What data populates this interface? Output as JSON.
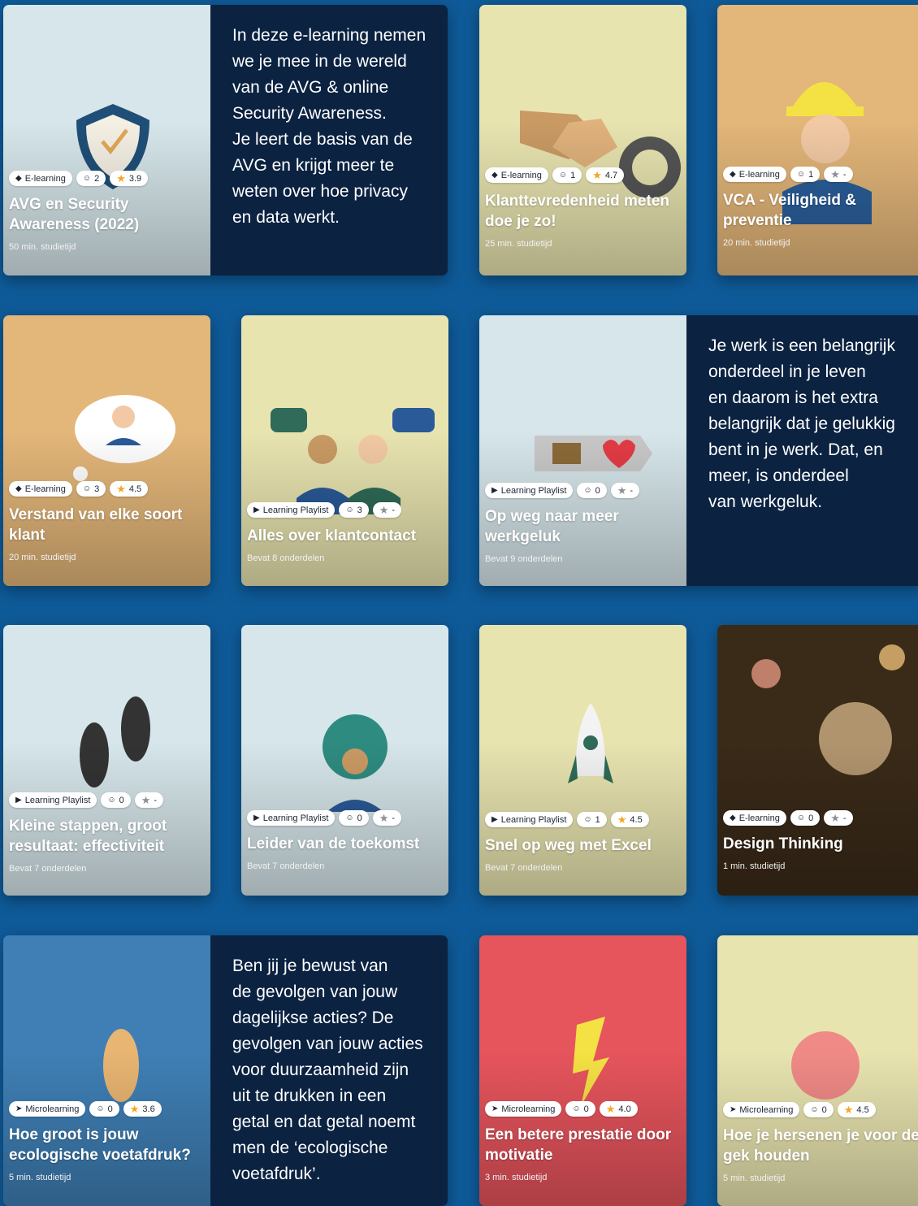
{
  "cards": [
    {
      "type": "E-learning",
      "type_icon": "graduation-cap-icon",
      "enrolled": "2",
      "rating": "3.9",
      "title": "AVG en Security Awareness (2022)",
      "sub": "50 min. studietijd",
      "bg": "#d6e6ea",
      "illustration": "shield-check",
      "description": "In deze e-learning nemen\nwe je mee in de wereld\nvan de AVG & online\nSecurity Awareness.\nJe leert de basis van de\nAVG en krijgt meer te\nweten over hoe privacy\nen data werkt."
    },
    {
      "type": "E-learning",
      "type_icon": "graduation-cap-icon",
      "enrolled": "1",
      "rating": "4.7",
      "title": "Klanttevredenheid meten doe je zo!",
      "sub": "25 min. studietijd",
      "bg": "#e8e4b0",
      "illustration": "handshake-gauge"
    },
    {
      "type": "E-learning",
      "type_icon": "graduation-cap-icon",
      "enrolled": "1",
      "rating": "-",
      "title": "VCA - Veiligheid & preventie",
      "sub": "20 min. studietijd",
      "bg": "#e3b679",
      "illustration": "construction-worker"
    },
    {
      "type": "E-learning",
      "type_icon": "graduation-cap-icon",
      "enrolled": "3",
      "rating": "4.5",
      "title": "Verstand van elke soort klant",
      "sub": "20 min. studietijd",
      "bg": "#e3b679",
      "illustration": "thought-cloud-person"
    },
    {
      "type": "Learning Playlist",
      "type_icon": "play-icon",
      "enrolled": "3",
      "rating": "-",
      "title": "Alles over klantcontact",
      "sub": "Bevat 8 onderdelen",
      "bg": "#e8e4b0",
      "illustration": "two-people-chat"
    },
    {
      "type": "Learning Playlist",
      "type_icon": "play-icon",
      "enrolled": "0",
      "rating": "-",
      "title": "Op weg naar meer werkgeluk",
      "sub": "Bevat 9 onderdelen",
      "bg": "#d6e6ea",
      "illustration": "briefcase-heart",
      "description": "Je werk is een belangrijk\nonderdeel in je leven\nen daarom is het extra\nbelangrijk dat je gelukkig\nbent in je werk. Dat, en\nmeer, is onderdeel\nvan werkgeluk."
    },
    {
      "type": "Learning Playlist",
      "type_icon": "play-icon",
      "enrolled": "0",
      "rating": "-",
      "title": "Kleine stappen, groot resultaat: effectiviteit",
      "sub": "Bevat 7 onderdelen",
      "bg": "#d6e6ea",
      "illustration": "footprints"
    },
    {
      "type": "Learning Playlist",
      "type_icon": "play-icon",
      "enrolled": "0",
      "rating": "-",
      "title": "Leider van de toekomst",
      "sub": "Bevat 7 onderdelen",
      "bg": "#d6e6ea",
      "illustration": "globe-woman"
    },
    {
      "type": "Learning Playlist",
      "type_icon": "play-icon",
      "enrolled": "1",
      "rating": "4.5",
      "title": "Snel op weg met Excel",
      "sub": "Bevat 7 onderdelen",
      "bg": "#e8e4b0",
      "illustration": "rocket"
    },
    {
      "type": "E-learning",
      "type_icon": "graduation-cap-icon",
      "enrolled": "0",
      "rating": "-",
      "title": "Design Thinking",
      "sub": "1 min. studietijd",
      "bg": "#3a2a18",
      "illustration": "sparkler-photo"
    },
    {
      "type": "Microlearning",
      "type_icon": "lightning-icon",
      "enrolled": "0",
      "rating": "3.6",
      "title": "Hoe groot is jouw ecologische voetafdruk?",
      "sub": "5 min. studietijd",
      "bg": "#3f7fb5",
      "illustration": "footprint",
      "description": "Ben jij je bewust van\nde gevolgen van jouw\ndagelijkse acties? De\ngevolgen van jouw acties\nvoor duurzaamheid zijn\nuit te drukken in een\ngetal en dat getal noemt\nmen de ‘ecologische\nvoetafdruk’."
    },
    {
      "type": "Microlearning",
      "type_icon": "lightning-icon",
      "enrolled": "0",
      "rating": "4.0",
      "title": "Een betere prestatie door motivatie",
      "sub": "3 min. studietijd",
      "bg": "#e6545c",
      "illustration": "lightning-chart"
    },
    {
      "type": "Microlearning",
      "type_icon": "lightning-icon",
      "enrolled": "0",
      "rating": "4.5",
      "title": "Hoe je hersenen je voor de gek houden",
      "sub": "5 min. studietijd",
      "bg": "#e8e4b0",
      "illustration": "brain"
    }
  ],
  "colors": {
    "page_bg": "#0e5a98",
    "description_bg": "#0b2241",
    "star": "#f5a623"
  }
}
